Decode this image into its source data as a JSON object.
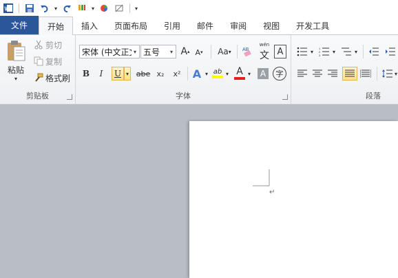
{
  "quick_access": {
    "app_icon": "word-icon",
    "buttons": [
      "save-icon",
      "undo-icon",
      "redo-icon",
      "format-painter-icon",
      "color-icon",
      "clear-icon",
      "customize-icon"
    ]
  },
  "tabs": [
    {
      "label": "文件"
    },
    {
      "label": "开始"
    },
    {
      "label": "插入"
    },
    {
      "label": "页面布局"
    },
    {
      "label": "引用"
    },
    {
      "label": "邮件"
    },
    {
      "label": "审阅"
    },
    {
      "label": "视图"
    },
    {
      "label": "开发工具"
    }
  ],
  "clipboard": {
    "group_label": "剪贴板",
    "paste": "粘贴",
    "cut": "剪切",
    "copy": "复制",
    "format_painter": "格式刷"
  },
  "font": {
    "group_label": "字体",
    "font_name": "宋体 (中文正文",
    "font_size": "五号",
    "grow": "A",
    "shrink": "A",
    "change_case": "Aa",
    "phonetic": "wén",
    "phonetic_char": "文",
    "border_char": "A",
    "bold": "B",
    "italic": "I",
    "underline": "U",
    "strike": "abe",
    "subscript": "x₂",
    "superscript": "x²",
    "effects": "A",
    "highlight": "ab",
    "font_color": "A",
    "char_shading": "A",
    "enclose": "字"
  },
  "paragraph": {
    "group_label": "段落"
  },
  "colors": {
    "file_tab": "#2b579a",
    "highlight_yellow": "#ffff00",
    "font_red": "#e02020",
    "effects_blue": "#4a7fd0"
  }
}
